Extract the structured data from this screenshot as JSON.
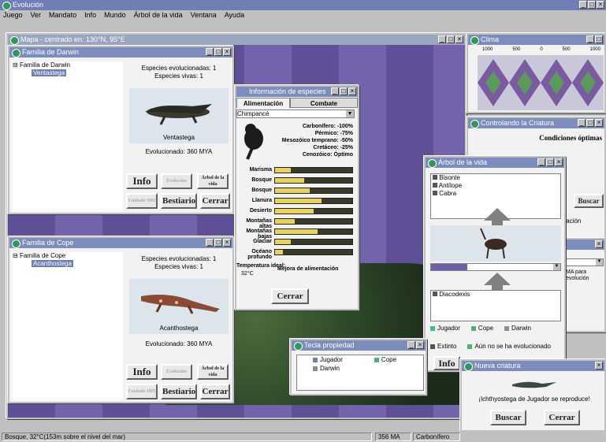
{
  "app": {
    "title": "Evolución"
  },
  "menu": [
    "Juego",
    "Ver",
    "Mandato",
    "Info",
    "Mundo",
    "Árbol de la vida",
    "Ventana",
    "Ayuda"
  ],
  "map_window": {
    "title": "Mapa - centrado en: 130°N, 95°E"
  },
  "darwin_window": {
    "title": "Familia de Darwin",
    "tree_root": "Familia de Darwin",
    "tree_child": "Ventastega",
    "species_evolved": "Especies evolucionadas: 1",
    "species_alive": "Especies vivas: 1",
    "creature_name": "Ventastega",
    "evolved": "Evolucionado: 360 MYA",
    "buttons": {
      "info": "Info",
      "evolucion": "Evolución",
      "arbol": "Árbol de la vida",
      "cuidado": "Cuidado MIS",
      "bestiario": "Bestiario",
      "cerrar": "Cerrar"
    }
  },
  "cope_window": {
    "title": "Familia de Cope",
    "tree_root": "Familia de Cope",
    "tree_child": "Acanthostega",
    "species_evolved": "Especies evolucionadas: 1",
    "species_alive": "Especies vivas: 1",
    "creature_name": "Acanthostega",
    "evolved": "Evolucionado: 360 MYA",
    "buttons": {
      "info": "Info",
      "evolucion": "Evolución",
      "arbol": "Árbol de la vida",
      "cuidado": "Cuidado MIS",
      "bestiario": "Bestiario",
      "cerrar": "Cerrar"
    }
  },
  "species_window": {
    "title": "Información de especies",
    "tab_alimentacion": "Alimentación",
    "tab_combate": "Combate",
    "dropdown": "Chimpancé",
    "climate": [
      "Carbonífero: -100%",
      "Pérmico: -75%",
      "Mesozóico temprano: -50%",
      "Cretáceo: -25%",
      "Cenozóico: Óptimo"
    ],
    "habitats": [
      {
        "label": "Marisma",
        "value": 0.2
      },
      {
        "label": "Bosque",
        "value": 0.38
      },
      {
        "label": "Bosque",
        "value": 0.45
      },
      {
        "label": "Llanura",
        "value": 0.6
      },
      {
        "label": "Desierto",
        "value": 0.5
      },
      {
        "label": "Montañas altas",
        "value": 0.25
      },
      {
        "label": "Montañas bajas",
        "value": 0.55
      },
      {
        "label": "Glaciar",
        "value": 0.2
      },
      {
        "label": "Océano profundo",
        "value": 0.1
      }
    ],
    "temp_label": "Temperatura ideal:",
    "temp_value": "32°C",
    "improve": "Mejora de alimentación",
    "close": "Cerrar"
  },
  "graph_window": {
    "title": "Clima",
    "ticks": [
      "1000",
      "500",
      "0",
      "500",
      "1000"
    ]
  },
  "control_window": {
    "title": "Controlando la Criatura",
    "optimal": "Condiciones óptimas",
    "buscar": "Buscar",
    "tacion": "tación"
  },
  "tree_window": {
    "title": "Árbol de la vida",
    "top_list": [
      "Bisonte",
      "Antílope",
      "Cabra"
    ],
    "bottom_list": [
      "Diacodexis"
    ],
    "legend": [
      {
        "label": "Jugador",
        "color": "#3fb8a0"
      },
      {
        "label": "Cope",
        "color": "#4fb07a"
      },
      {
        "label": "Darwin",
        "color": "#8a8a9a"
      },
      {
        "label": "Extinto",
        "color": "#555555"
      },
      {
        "label": "Aún no se ha evolucionado",
        "color": "#4fb07a"
      }
    ],
    "info": "Info"
  },
  "side_window": {
    "text1": "MA para",
    "text2": "evolución"
  },
  "key_window": {
    "title": "Tecla propiedad",
    "items": [
      "Jugador",
      "Cope",
      "Darwin"
    ]
  },
  "new_creature": {
    "title": "Nueva criatura",
    "message": "¡Ichthyostega de Jugador se reproduce!",
    "buscar": "Buscar",
    "cerrar": "Cerrar"
  },
  "status": {
    "location": "Bosque, 32°C(153m sobre el nivel del mar)",
    "time": "356 MA",
    "period": "Carbonífero"
  },
  "colors": {
    "title_active": "#7b8cbd",
    "map_purple": "#6a5aa0",
    "accent_green": "#2f9a57"
  }
}
